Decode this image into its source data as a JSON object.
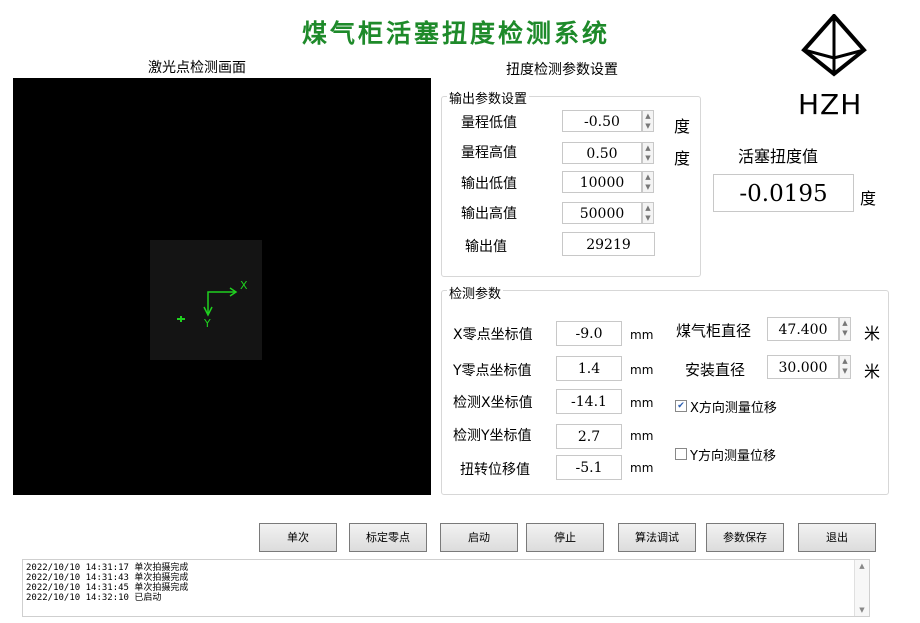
{
  "app": {
    "title": "煤气柜活塞扭度检测系统",
    "logo_text": "HZH"
  },
  "camera": {
    "caption": "激光点检测画面",
    "axis_x": "X",
    "axis_y": "Y"
  },
  "params_caption": "扭度检测参数设置",
  "output_group": {
    "title": "输出参数设置",
    "rows": [
      {
        "label": "量程低值",
        "value": "-0.50",
        "unit": "度"
      },
      {
        "label": "量程高值",
        "value": "0.50",
        "unit": "度"
      },
      {
        "label": "输出低值",
        "value": "10000",
        "unit": ""
      },
      {
        "label": "输出高值",
        "value": "50000",
        "unit": ""
      }
    ],
    "output_label": "输出值",
    "output_value": "29219"
  },
  "twist": {
    "label": "活塞扭度值",
    "value": "-0.0195",
    "unit": "度"
  },
  "detect_group": {
    "title": "检测参数",
    "rows": [
      {
        "label": "X零点坐标值",
        "value": "-9.0",
        "unit": "mm"
      },
      {
        "label": "Y零点坐标值",
        "value": "1.4",
        "unit": "mm"
      },
      {
        "label": "检测X坐标值",
        "value": "-14.1",
        "unit": "mm"
      },
      {
        "label": "检测Y坐标值",
        "value": "2.7",
        "unit": "mm"
      },
      {
        "label": "扭转位移值",
        "value": "-5.1",
        "unit": "mm"
      }
    ],
    "diameter_label": "煤气柜直径",
    "diameter_value": "47.400",
    "diameter_unit": "米",
    "install_label": "安装直径",
    "install_value": "30.000",
    "install_unit": "米",
    "check_x": {
      "label": "X方向测量位移",
      "checked": true
    },
    "check_y": {
      "label": "Y方向测量位移",
      "checked": false
    }
  },
  "buttons": [
    "单次",
    "标定零点",
    "启动",
    "停止",
    "算法调试",
    "参数保存",
    "退出"
  ],
  "log": [
    "2022/10/10 14:31:17 单次拍摄完成",
    "2022/10/10 14:31:43 单次拍摄完成",
    "2022/10/10 14:31:45 单次拍摄完成",
    "2022/10/10 14:32:10 已启动"
  ]
}
